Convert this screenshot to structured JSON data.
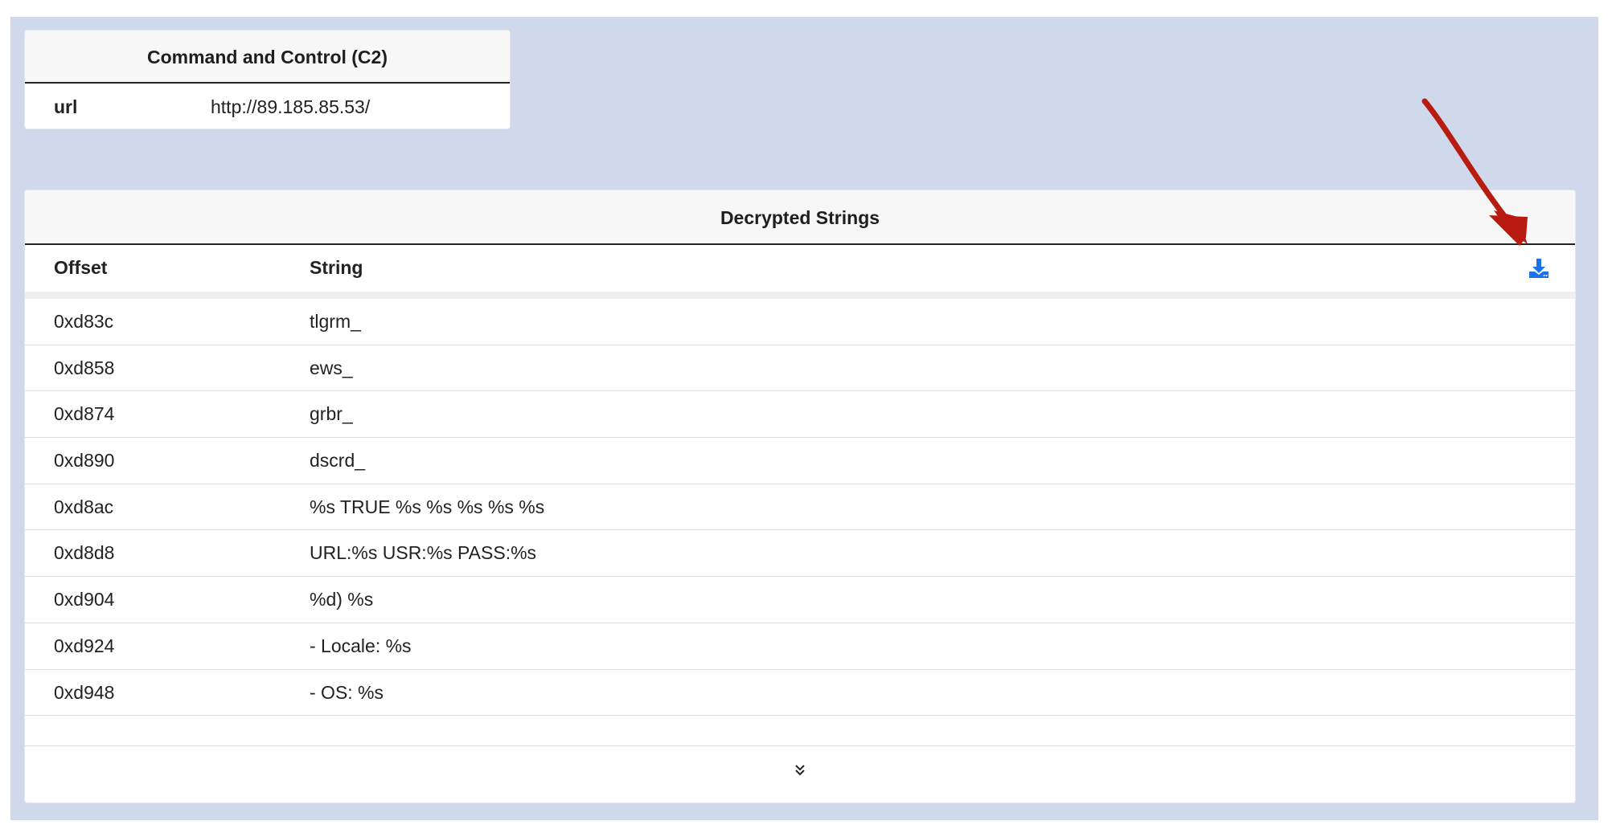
{
  "c2": {
    "title": "Command and Control (C2)",
    "rows": [
      {
        "key": "url",
        "value": "http://89.185.85.53/"
      }
    ]
  },
  "decrypted": {
    "title": "Decrypted Strings",
    "columns": {
      "offset": "Offset",
      "string": "String"
    },
    "rows": [
      {
        "offset": "0xd83c",
        "string": "tlgrm_"
      },
      {
        "offset": "0xd858",
        "string": "ews_"
      },
      {
        "offset": "0xd874",
        "string": "grbr_"
      },
      {
        "offset": "0xd890",
        "string": "dscrd_"
      },
      {
        "offset": "0xd8ac",
        "string": "%s TRUE %s %s %s %s %s"
      },
      {
        "offset": "0xd8d8",
        "string": "URL:%s USR:%s PASS:%s"
      },
      {
        "offset": "0xd904",
        "string": "%d) %s"
      },
      {
        "offset": "0xd924",
        "string": "- Locale: %s"
      },
      {
        "offset": "0xd948",
        "string": "- OS: %s"
      }
    ],
    "download_icon": "download-icon",
    "expand_icon": "chevron-double-down-icon"
  },
  "colors": {
    "background": "#d0d9ec",
    "accent": "#1a73e8",
    "annotation_arrow": "#b81c10"
  }
}
